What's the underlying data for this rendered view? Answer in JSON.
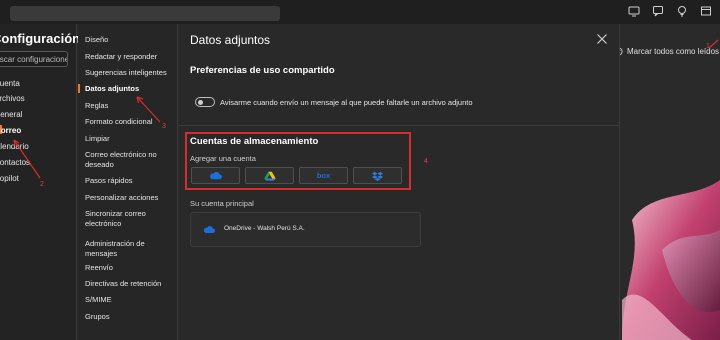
{
  "settings": {
    "title": "Configuración",
    "search_placeholder": "Buscar configuraciones",
    "nav": [
      {
        "label": "Cuenta"
      },
      {
        "label": "Archivos"
      },
      {
        "label": "General"
      },
      {
        "label": "Correo",
        "active": true
      },
      {
        "label": "Calendario"
      },
      {
        "label": "Contactos"
      },
      {
        "label": "Copilot"
      }
    ]
  },
  "mail_settings": {
    "items": [
      {
        "label": "Diseño"
      },
      {
        "label": "Redactar y responder"
      },
      {
        "label": "Sugerencias inteligentes"
      },
      {
        "label": "Datos adjuntos",
        "active": true
      },
      {
        "label": "Reglas"
      },
      {
        "label": "Formato condicional"
      },
      {
        "label": "Limpiar"
      },
      {
        "label": "Correo electrónico no deseado"
      },
      {
        "label": "Pasos rápidos"
      },
      {
        "label": "Personalizar acciones"
      },
      {
        "label": "Sincronizar correo electrónico"
      },
      {
        "label": "Administración de mensajes"
      },
      {
        "label": "Reenvío"
      },
      {
        "label": "Directivas de retención"
      },
      {
        "label": "S/MIME"
      },
      {
        "label": "Grupos"
      }
    ]
  },
  "content": {
    "title": "Datos adjuntos",
    "sharing_title": "Preferencias de uso compartido",
    "toggle_label": "Avisarme cuando envío un mensaje al que puede faltarle un archivo adjunto",
    "toggle_on": false,
    "storage_title": "Cuentas de almacenamiento",
    "add_account_label": "Agregar una cuenta",
    "providers": [
      {
        "icon": "onedrive-icon"
      },
      {
        "icon": "google-drive-icon"
      },
      {
        "icon": "box-icon",
        "label": "box"
      },
      {
        "icon": "dropbox-icon"
      }
    ],
    "primary_account_label": "Su cuenta principal",
    "primary_account_name": "OneDrive - Walsh Perú S.A."
  },
  "background": {
    "mark_all_read": "Marcar todos como leídos"
  },
  "annotations": {
    "n1": "1",
    "n2": "2",
    "n3": "3",
    "n4": "4"
  },
  "colors": {
    "accent": "#f07630",
    "annotation_red": "#d62d2d",
    "onedrive_blue": "#1d6fd8",
    "box_blue": "#1d6fd8",
    "dropbox_blue": "#2b7ee0"
  }
}
